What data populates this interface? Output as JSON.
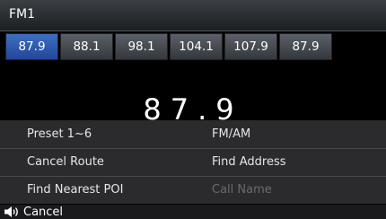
{
  "header": {
    "title": "FM1"
  },
  "presets": [
    "87.9",
    "88.1",
    "98.1",
    "104.1",
    "107.9",
    "87.9"
  ],
  "display": {
    "frequency": "87.9"
  },
  "menu": {
    "rows": [
      [
        "Preset 1~6",
        "FM/AM"
      ],
      [
        "Cancel Route",
        "Find Address"
      ],
      [
        "Find Nearest POI",
        "Call Name"
      ]
    ]
  },
  "footer": {
    "cancel_label": "Cancel",
    "icon": "speaker-icon"
  }
}
